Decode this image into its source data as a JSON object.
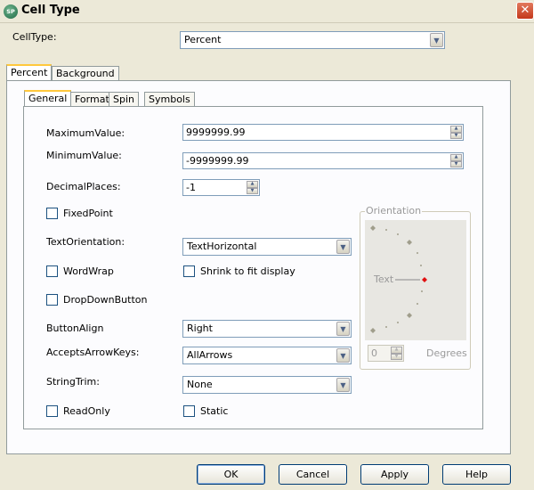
{
  "window": {
    "title": "Cell Type",
    "icon_text": "SP",
    "close_glyph": "✕"
  },
  "celltype": {
    "label": "CellType:",
    "value": "Percent"
  },
  "outer_tabs": [
    {
      "label": "Percent"
    },
    {
      "label": "Background"
    }
  ],
  "inner_tabs": [
    {
      "label": "General"
    },
    {
      "label": "Format"
    },
    {
      "label": "Spin"
    },
    {
      "label": "Symbols"
    }
  ],
  "general": {
    "maximum": {
      "label": "MaximumValue:",
      "value": "9999999.99"
    },
    "minimum": {
      "label": "MinimumValue:",
      "value": "-9999999.99"
    },
    "decimal": {
      "label": "DecimalPlaces:",
      "value": "-1"
    },
    "fixed_point": {
      "label": "FixedPoint"
    },
    "text_orientation": {
      "label": "TextOrientation:",
      "value": "TextHorizontal"
    },
    "word_wrap": {
      "label": "WordWrap"
    },
    "shrink": {
      "label": "Shrink to fit display"
    },
    "dropdown_button": {
      "label": "DropDownButton"
    },
    "button_align": {
      "label": "ButtonAlign",
      "value": "Right"
    },
    "accepts_arrow_keys": {
      "label": "AcceptsArrowKeys:",
      "value": "AllArrows"
    },
    "string_trim": {
      "label": "StringTrim:",
      "value": "None"
    },
    "read_only": {
      "label": "ReadOnly"
    },
    "static": {
      "label": "Static"
    }
  },
  "orientation": {
    "legend": "Orientation",
    "preview_text": "Text",
    "degrees_value": "0",
    "degrees_label": "Degrees"
  },
  "buttons": {
    "ok": "OK",
    "cancel": "Cancel",
    "apply": "Apply",
    "help": "Help"
  },
  "colors": {
    "tab_highlight": "#FFC83C",
    "control_border": "#7F9DB9",
    "checkbox_border": "#1C5180",
    "orientation_marker": "#E01010"
  }
}
